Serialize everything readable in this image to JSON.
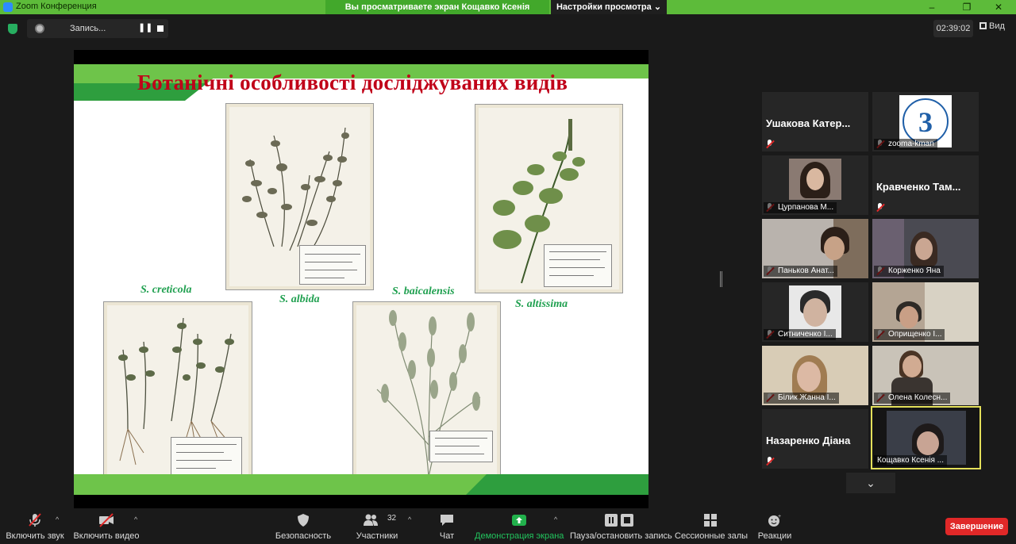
{
  "window": {
    "app_title": "Zoom Конференция",
    "share_banner": "Вы просматриваете экран Кощавко Ксенія Сергіївна",
    "view_settings": "Настройки просмотра ⌄",
    "minimize": "–",
    "restore": "❐",
    "close": "✕"
  },
  "topbar": {
    "recording_label": "Запись...",
    "pause_glyph": "❚❚",
    "timer": "02:39:02",
    "view_label": "Вид"
  },
  "slide": {
    "title": "Ботанічні особливості досліджуваних видів",
    "captions": {
      "creticola": "S. creticola",
      "albida": "S. albida",
      "baicalensis": "S. baicalensis",
      "altissima": "S. altissima"
    }
  },
  "participants": [
    {
      "name": "Ушакова Катер...",
      "display": "name-only"
    },
    {
      "name": "zooma-kman",
      "display": "logo"
    },
    {
      "name": "Цурпанова М...",
      "display": "photo"
    },
    {
      "name": "Кравченко Там...",
      "display": "name-only"
    },
    {
      "name": "Паньков Анат...",
      "display": "video"
    },
    {
      "name": "Корженко Яна",
      "display": "video"
    },
    {
      "name": "Ситниченко І...",
      "display": "photo"
    },
    {
      "name": "Оприщенко І...",
      "display": "video"
    },
    {
      "name": "Білик Жанна І...",
      "display": "video"
    },
    {
      "name": "Олена Колесн...",
      "display": "video"
    },
    {
      "name": "Назаренко Діана",
      "display": "name-only"
    },
    {
      "name": "Кощавко Ксенія ...",
      "display": "video",
      "active_speaker": true
    }
  ],
  "logo_text": "3",
  "toolbar": {
    "audio": "Включить звук",
    "video": "Включить видео",
    "security": "Безопасность",
    "participants": "Участники",
    "participants_count": "32",
    "chat": "Чат",
    "share": "Демонстрация экрана",
    "record": "Пауза/остановить запись",
    "breakout": "Сессионные залы",
    "reactions": "Реакции",
    "end": "Завершение"
  },
  "colors": {
    "zoom_green": "#5dbb3a",
    "slide_title_red": "#c00018",
    "caption_green": "#20a050",
    "end_red": "#e02828",
    "active_speaker": "#e4e05a"
  }
}
